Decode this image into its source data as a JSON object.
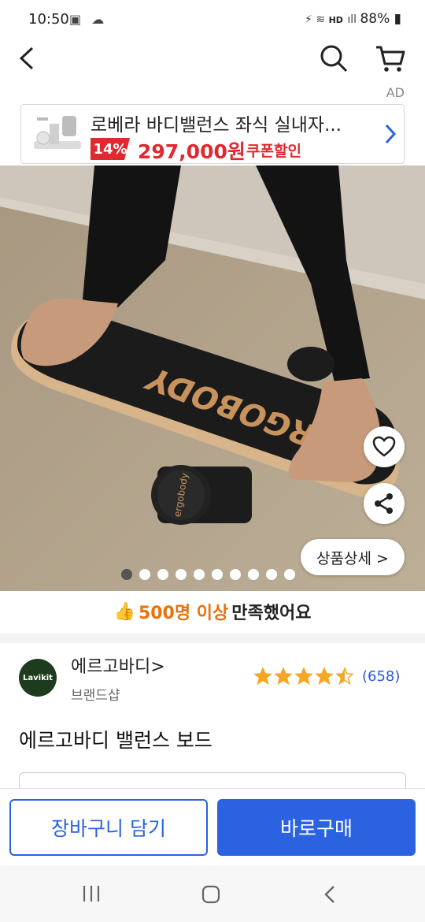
{
  "status": {
    "time": "10:50",
    "battery": "88%",
    "net": "HD"
  },
  "header": {
    "ad_label": "AD"
  },
  "ad": {
    "title": "로베라 바디밸런스 좌식 실내자...",
    "discount": "14%",
    "price": "297,000원",
    "coupon": "쿠폰할인"
  },
  "hero": {
    "board_text": "ERGOBODY",
    "roller_text": "ergobody",
    "detail_label": "상품상세 >",
    "slides": 10,
    "active_slide": 1
  },
  "satisfaction": {
    "icon": "👍",
    "highlight": "500명 이상",
    "rest": "만족했어요"
  },
  "brand": {
    "logo_text": "Lavikit",
    "name": "에르고바디>",
    "subtitle": "브랜드샵",
    "rating": 4.5,
    "reviews": "(658)"
  },
  "product": {
    "title": "에르고바디 밸런스 보드"
  },
  "actions": {
    "cart": "장바구니 담기",
    "buy": "바로구매"
  },
  "colors": {
    "accent": "#2a62e0",
    "sale": "#e0282e",
    "highlight": "#e8720c",
    "star": "#f5a623"
  }
}
